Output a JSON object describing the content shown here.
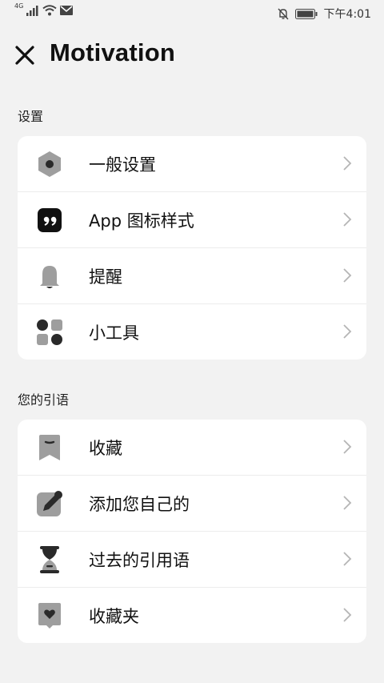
{
  "status_bar": {
    "network": "4G",
    "time": "下午4:01"
  },
  "header": {
    "title": "Motivation"
  },
  "sections": [
    {
      "label": "设置",
      "items": [
        {
          "label": "一般设置",
          "icon": "hexagon-settings-icon"
        },
        {
          "label": "App 图标样式",
          "icon": "quote-app-icon"
        },
        {
          "label": "提醒",
          "icon": "bell-icon"
        },
        {
          "label": "小工具",
          "icon": "widgets-grid-icon"
        }
      ]
    },
    {
      "label": "您的引语",
      "items": [
        {
          "label": "收藏",
          "icon": "bookmark-icon"
        },
        {
          "label": "添加您自己的",
          "icon": "edit-pencil-icon"
        },
        {
          "label": "过去的引用语",
          "icon": "hourglass-icon"
        },
        {
          "label": "收藏夹",
          "icon": "heart-folder-icon"
        }
      ]
    }
  ],
  "colors": {
    "background": "#f2f2f2",
    "card": "#ffffff",
    "icon_gray": "#9e9e9e",
    "icon_dark": "#2a2a2a"
  }
}
